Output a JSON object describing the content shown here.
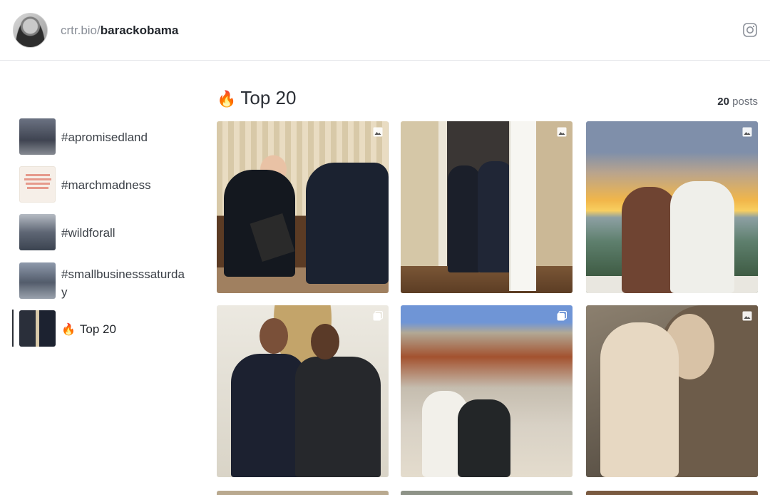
{
  "header": {
    "domain": "crtr.bio/",
    "handle": "barackobama",
    "social_icon": "instagram-icon"
  },
  "sidebar": {
    "items": [
      {
        "label": "#apromisedland",
        "thumb": "#5d6471",
        "active": false
      },
      {
        "label": "#marchmadness",
        "thumb": "#f4ece4",
        "active": false
      },
      {
        "label": "#wildforall",
        "thumb": "#6c7686",
        "active": false
      },
      {
        "label": "#smallbusinesssaturday",
        "thumb": "#6a7380",
        "active": false
      },
      {
        "label": "Top 20",
        "icon": "fire-icon",
        "active": true
      }
    ]
  },
  "main": {
    "title": "Top 20",
    "title_icon": "fire-icon",
    "post_count": "20",
    "post_count_suffix": "posts",
    "posts": [
      {
        "type": "image",
        "badge_icon": "image-icon"
      },
      {
        "type": "image",
        "badge_icon": "image-icon"
      },
      {
        "type": "image",
        "badge_icon": "image-icon"
      },
      {
        "type": "carousel",
        "badge_icon": "carousel-icon"
      },
      {
        "type": "carousel",
        "badge_icon": "carousel-icon"
      },
      {
        "type": "image",
        "badge_icon": "image-icon"
      }
    ]
  }
}
